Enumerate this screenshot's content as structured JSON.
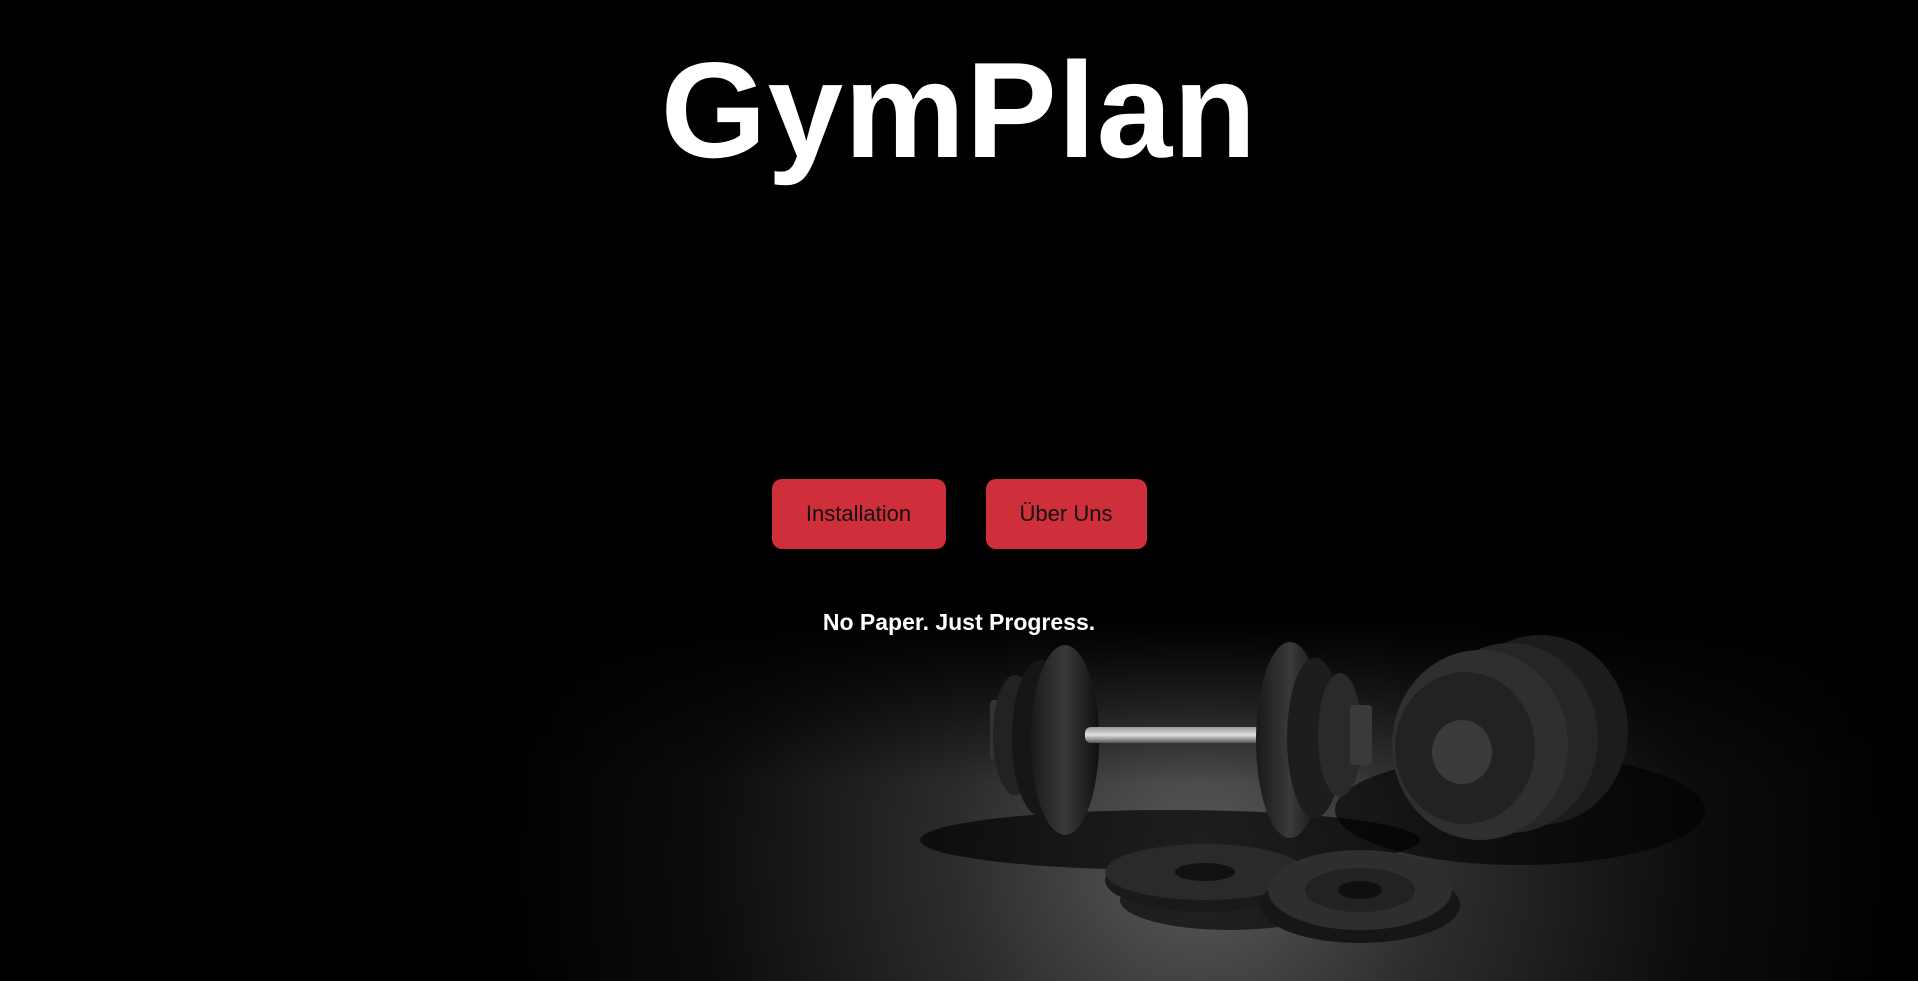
{
  "hero": {
    "title": "GymPlan",
    "tagline": "No Paper. Just Progress."
  },
  "buttons": {
    "installation_label": "Installation",
    "about_label": "Über Uns"
  },
  "background": {
    "image_subject": "dumbbell-and-weight-plates",
    "base_color": "#000000"
  },
  "colors": {
    "accent": "#cf2f3a",
    "text": "#ffffff"
  }
}
